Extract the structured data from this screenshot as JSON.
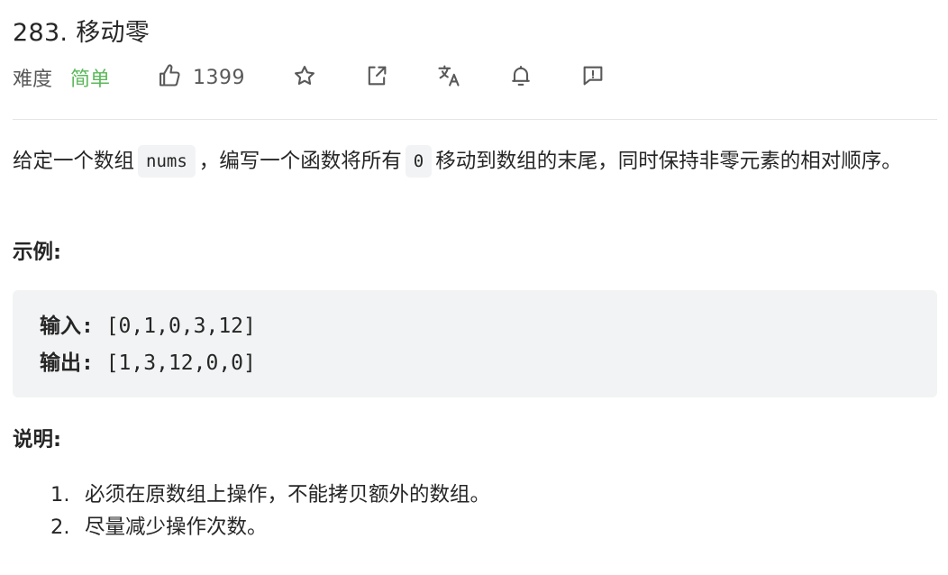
{
  "problem": {
    "title": "283. 移动零"
  },
  "meta": {
    "difficulty_label": "难度",
    "difficulty_value": "简单",
    "difficulty_color": "#5cb85c",
    "like_count": "1399",
    "icons": [
      "thumbs-up-icon",
      "star-icon",
      "share-icon",
      "translate-icon",
      "bell-icon",
      "feedback-icon"
    ]
  },
  "description": {
    "part1": "给定一个数组",
    "code1": "nums",
    "part2": "，编写一个函数将所有",
    "code2": "0",
    "part3": "移动到数组的末尾，同时保持非零元素的相对顺序。"
  },
  "example": {
    "heading": "示例:",
    "input_label": "输入:",
    "input_value": " [0,1,0,3,12]",
    "output_label": "输出:",
    "output_value": " [1,3,12,0,0]"
  },
  "notes": {
    "heading": "说明:",
    "items": [
      {
        "num": "1.",
        "text": "必须在原数组上操作，不能拷贝额外的数组。"
      },
      {
        "num": "2.",
        "text": "尽量减少操作次数。"
      }
    ]
  }
}
